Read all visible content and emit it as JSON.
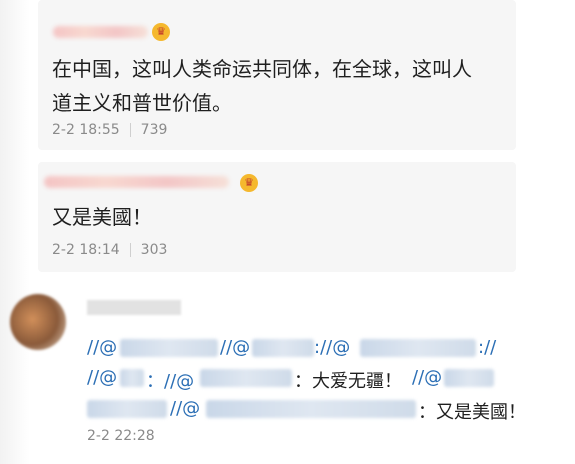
{
  "comments": [
    {
      "text": "在中国，这叫人类命运共同体，在全球，这叫人道主义和普世价值。",
      "line1": "在中国，这叫人类命运共同体，在全球，这叫人",
      "line2": "道主义和普世价值。",
      "time": "2-2 18:55",
      "likes": "739"
    },
    {
      "text": "又是美國！",
      "time": "2-2 18:14",
      "likes": "303"
    }
  ],
  "repost": {
    "prefix1": "//@",
    "prefix2": "//@",
    "prefix3": "://@",
    "prefix4": "://",
    "prefix5": "//@",
    "prefix6": "：//@",
    "seg_love": "：大爱无疆！",
    "prefix7": "//@",
    "prefix8": "//@",
    "seg_end": "：又是美國！",
    "time": "2-2 22:28"
  },
  "icons": {
    "vip_badge": "crown-icon"
  }
}
